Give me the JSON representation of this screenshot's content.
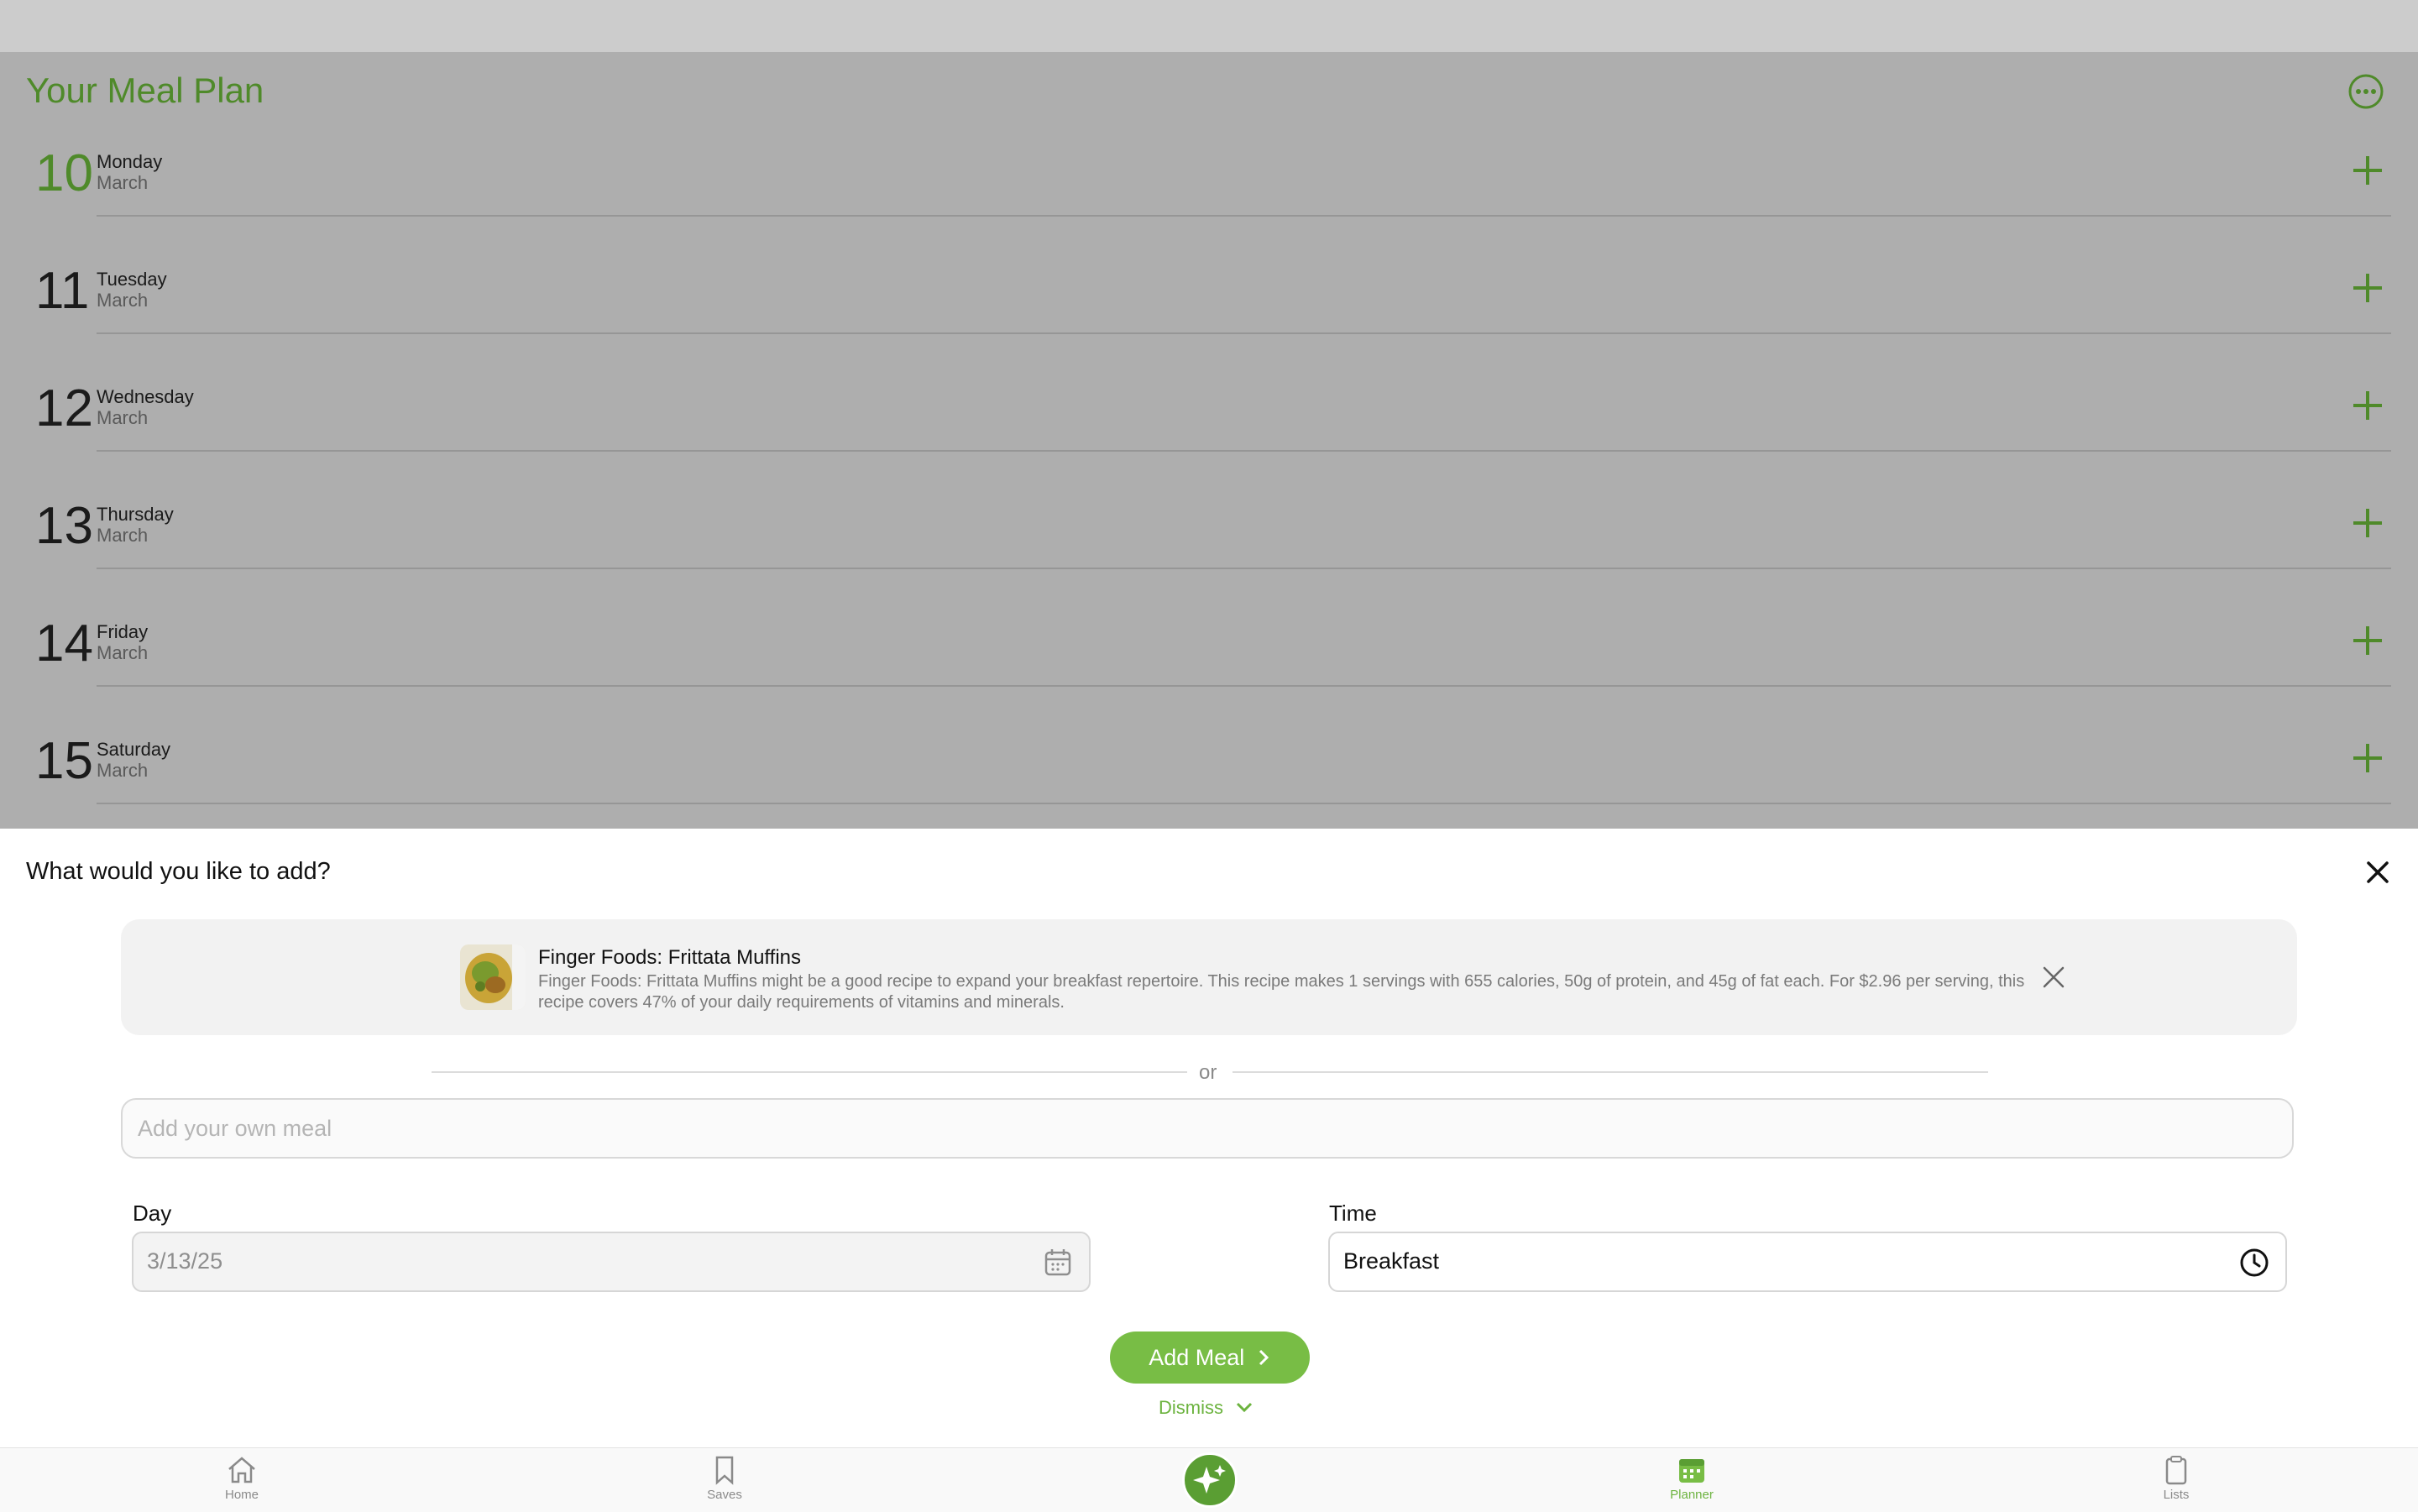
{
  "planner": {
    "title": "Your Meal Plan",
    "days": [
      {
        "number": "10",
        "weekday": "Monday",
        "month": "March",
        "today": true
      },
      {
        "number": "11",
        "weekday": "Tuesday",
        "month": "March"
      },
      {
        "number": "12",
        "weekday": "Wednesday",
        "month": "March"
      },
      {
        "number": "13",
        "weekday": "Thursday",
        "month": "March"
      },
      {
        "number": "14",
        "weekday": "Friday",
        "month": "March"
      },
      {
        "number": "15",
        "weekday": "Saturday",
        "month": "March"
      }
    ]
  },
  "sheet": {
    "title": "What would you like to add?",
    "recipe": {
      "title": "Finger Foods: Frittata Muffins",
      "description": "Finger Foods: Frittata Muffins might be a good recipe to expand your breakfast repertoire. This recipe makes 1 servings with 655 calories, 50g of protein, and 45g of fat each. For $2.96 per serving, this recipe covers 47% of your daily requirements of vitamins and minerals."
    },
    "or_text": "or",
    "own_meal_placeholder": "Add your own meal",
    "day_label": "Day",
    "day_value": "3/13/25",
    "time_label": "Time",
    "time_value": "Breakfast",
    "add_button": "Add Meal",
    "dismiss": "Dismiss"
  },
  "tabbar": {
    "items": [
      {
        "label": "Home",
        "icon": "home-icon"
      },
      {
        "label": "Saves",
        "icon": "bookmark-icon"
      },
      {
        "label": "",
        "icon": "sparkle-icon"
      },
      {
        "label": "Planner",
        "icon": "calendar-icon",
        "active": true
      },
      {
        "label": "Lists",
        "icon": "clipboard-icon"
      }
    ]
  },
  "colors": {
    "accent": "#6cb33f",
    "accent_dark": "#4f8a2a",
    "overlay": "#aeaeae"
  }
}
